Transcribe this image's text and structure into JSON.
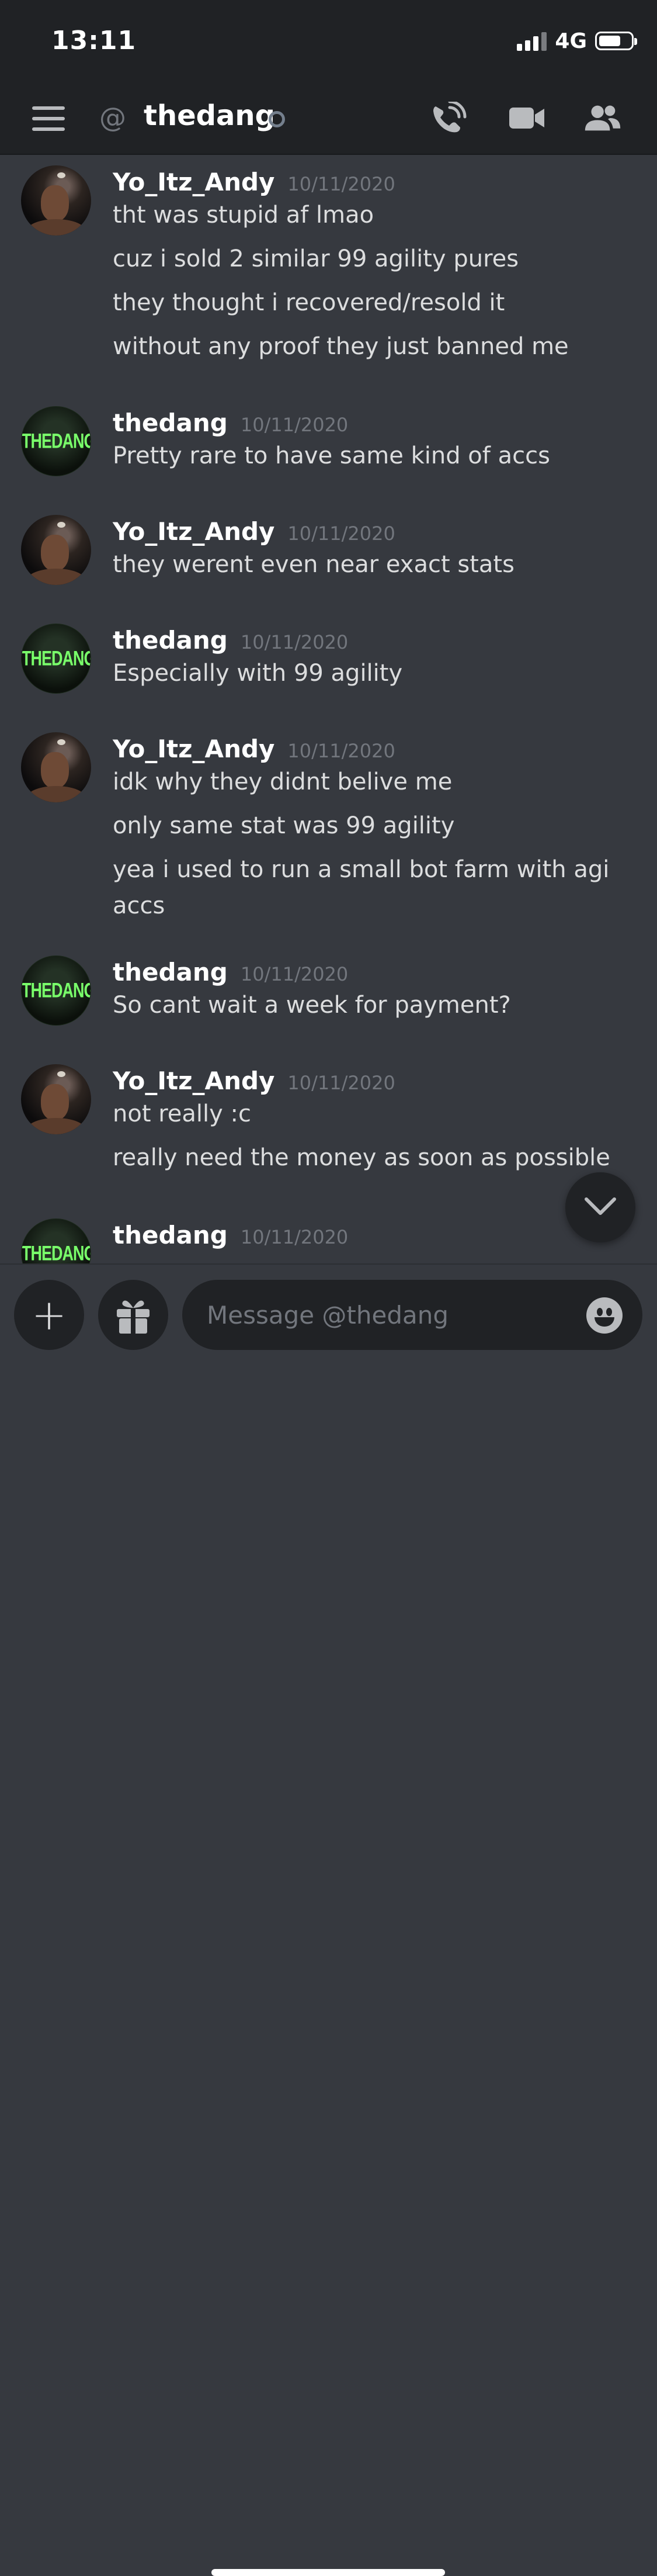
{
  "status_bar": {
    "time": "13:11",
    "network": "4G",
    "battery_level": 0.7
  },
  "header": {
    "channel_name": "thedang",
    "at_symbol": "@"
  },
  "messages": [
    {
      "author": "Yo_Itz_Andy",
      "timestamp": "10/11/2020",
      "avatar": "andy",
      "lines": [
        "tht was stupid af lmao",
        "cuz i sold 2 similar 99 agility pures",
        "they thought i recovered/resold it",
        "without any proof they just banned me"
      ]
    },
    {
      "author": "thedang",
      "timestamp": "10/11/2020",
      "avatar": "dang",
      "lines": [
        "Pretty rare to have same kind of accs"
      ]
    },
    {
      "author": "Yo_Itz_Andy",
      "timestamp": "10/11/2020",
      "avatar": "andy",
      "lines": [
        "they werent even near exact stats"
      ]
    },
    {
      "author": "thedang",
      "timestamp": "10/11/2020",
      "avatar": "dang",
      "lines": [
        "Especially with 99 agility"
      ]
    },
    {
      "author": "Yo_Itz_Andy",
      "timestamp": "10/11/2020",
      "avatar": "andy",
      "lines": [
        "idk why they didnt belive me",
        "only same stat was 99 agility",
        "yea i used to run a small bot farm with agi",
        "accs"
      ]
    },
    {
      "author": "thedang",
      "timestamp": "10/11/2020",
      "avatar": "dang",
      "lines": [
        "So cant wait a week for payment?"
      ]
    },
    {
      "author": "Yo_Itz_Andy",
      "timestamp": "10/11/2020",
      "avatar": "andy",
      "lines": [
        "not really :c",
        "really need the money as soon as possible"
      ]
    },
    {
      "author": "thedang",
      "timestamp": "10/11/2020",
      "avatar": "dang",
      "lines": []
    }
  ],
  "avatar_logo_text": "THEDANG",
  "composer": {
    "placeholder": "Message @thedang",
    "plus_label": "+"
  }
}
